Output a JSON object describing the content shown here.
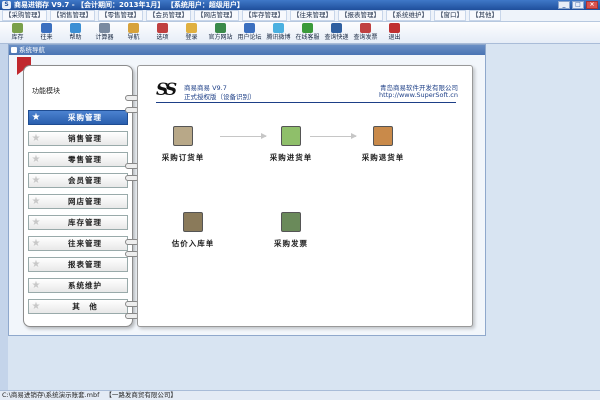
{
  "window": {
    "title": "商易进销存 V9.7 - 【会计期间：2013年1月】 【系统用户：超级用户】",
    "buttons": [
      "_",
      "□",
      "×"
    ]
  },
  "menu": {
    "items": [
      "【采购管理】",
      "【销售管理】",
      "【零售管理】",
      "【会员管理】",
      "【网店管理】",
      "【库存管理】",
      "【往来管理】",
      "【报表管理】",
      "【系统维护】",
      "【窗口】",
      "【其他】"
    ]
  },
  "toolbar": {
    "items": [
      {
        "label": "库存",
        "icon": "inventory-icon",
        "color": "#7aa04a"
      },
      {
        "label": "往来",
        "icon": "people-icon",
        "color": "#3b6fbf"
      },
      {
        "label": "帮助",
        "icon": "help-icon",
        "color": "#3b8fd4"
      },
      {
        "label": "计算器",
        "icon": "calculator-icon",
        "color": "#7a8aa0"
      },
      {
        "label": "导航",
        "icon": "navigation-icon",
        "color": "#d7a23b"
      },
      {
        "label": "选项",
        "icon": "options-icon",
        "color": "#c04040"
      },
      {
        "label": "登录",
        "icon": "login-icon",
        "color": "#e0b040"
      },
      {
        "label": "官方网站",
        "icon": "website-icon",
        "color": "#3a8a4a"
      },
      {
        "label": "用户论坛",
        "icon": "forum-icon",
        "color": "#3b6fbf"
      },
      {
        "label": "腾讯微博",
        "icon": "weibo-icon",
        "color": "#4ab0e0"
      },
      {
        "label": "在线客服",
        "icon": "service-icon",
        "color": "#3a9a3a"
      },
      {
        "label": "查询快递",
        "icon": "express-icon",
        "color": "#2f5fa0"
      },
      {
        "label": "查询发票",
        "icon": "invoice-search-icon",
        "color": "#c04040"
      },
      {
        "label": "退出",
        "icon": "exit-icon",
        "color": "#c03030"
      }
    ]
  },
  "panel": {
    "title": "系统导航"
  },
  "module_menu": {
    "heading": "功能模块",
    "items": [
      {
        "label": "采购管理",
        "active": true
      },
      {
        "label": "销售管理",
        "active": false
      },
      {
        "label": "零售管理",
        "active": false
      },
      {
        "label": "会员管理",
        "active": false
      },
      {
        "label": "网店管理",
        "active": false
      },
      {
        "label": "库存管理",
        "active": false
      },
      {
        "label": "往来管理",
        "active": false
      },
      {
        "label": "报表管理",
        "active": false
      },
      {
        "label": "系统维护",
        "active": false
      },
      {
        "label": "其　他",
        "active": false
      }
    ]
  },
  "content": {
    "logo": "SS",
    "app_name": "商易商易 V9.7",
    "edition": "正式授权版（设备识别）",
    "company": "青岛商易软件开发有限公司",
    "website": "http://www.SuperSoft.cn",
    "functions": [
      {
        "label": "采购订货单",
        "icon": "purchase-order-icon",
        "color": "#b8a888"
      },
      {
        "label": "采购进货单",
        "icon": "purchase-receipt-icon",
        "color": "#8fbf6a"
      },
      {
        "label": "采购退货单",
        "icon": "purchase-return-icon",
        "color": "#c98a4a"
      },
      {
        "label": "估价入库单",
        "icon": "estimate-stock-in-icon",
        "color": "#8a7a5a"
      },
      {
        "label": "采购发票",
        "icon": "purchase-invoice-icon",
        "color": "#6a8a5a"
      }
    ]
  },
  "status": {
    "path": "C:\\商易进销存\\系统演示账套.mbf",
    "company": "【一路发商贸有限公司】"
  }
}
